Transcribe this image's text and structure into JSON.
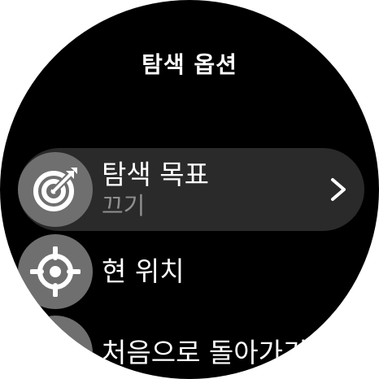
{
  "screen": {
    "title": "탐색 옵션"
  },
  "menu": {
    "items": [
      {
        "icon": "target-icon",
        "label": "탐색 목표",
        "value": "끄기",
        "selected": true,
        "has_chevron": true
      },
      {
        "icon": "crosshair-icon",
        "label": "현 위치"
      },
      {
        "icon": "return-icon",
        "label": "처음으로 돌아가기"
      }
    ]
  },
  "colors": {
    "background": "#000000",
    "selected_row": "#2a2a2a",
    "icon_circle": "#6f6f6f",
    "subtext": "#8f8f8f",
    "text": "#ffffff"
  }
}
